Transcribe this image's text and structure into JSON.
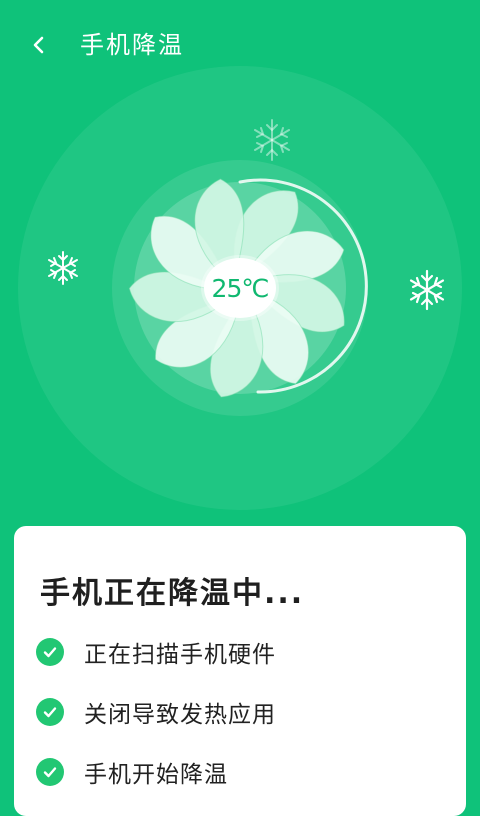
{
  "header": {
    "back_icon": "chevron-left-icon",
    "title": "手机降温"
  },
  "fan": {
    "temperature": "25℃",
    "icons": [
      "snowflake-icon",
      "fan-icon"
    ]
  },
  "card": {
    "title": "手机正在降温中...",
    "steps": [
      {
        "label": "正在扫描手机硬件",
        "status": "done"
      },
      {
        "label": "关闭导致发热应用",
        "status": "done"
      },
      {
        "label": "手机开始降温",
        "status": "done"
      }
    ]
  },
  "colors": {
    "background": "#0fc27a",
    "accent": "#22c773",
    "card": "#ffffff"
  }
}
